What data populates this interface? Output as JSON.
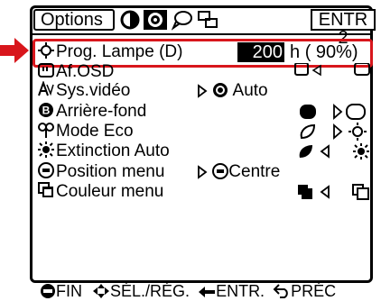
{
  "tabs": {
    "options": "Options",
    "entr": "ENTR 2"
  },
  "tab_icons": [
    "display-tab-icon",
    "options-tab-icon-selected",
    "speech-tab-icon",
    "network-tab-icon"
  ],
  "rows": [
    {
      "label": "Prog. Lampe (D)",
      "value": "200",
      "unit": "h",
      "percent": "( 90%)"
    },
    {
      "label": "Af.OSD"
    },
    {
      "label": "Sys.vidéo",
      "value": "Auto"
    },
    {
      "label": "Arrière-fond"
    },
    {
      "label": "Mode Eco"
    },
    {
      "label": "Extinction Auto"
    },
    {
      "label": "Position menu",
      "value": "Centre"
    },
    {
      "label": "Couleur menu"
    }
  ],
  "footer": {
    "fin": "FIN",
    "sel": "SÉL./RÉG.",
    "entr": "ENTR.",
    "prec": "PRÉC"
  },
  "colors": {
    "highlight": "#d8161c",
    "arrow": "#d8161c",
    "text": "#000000"
  }
}
